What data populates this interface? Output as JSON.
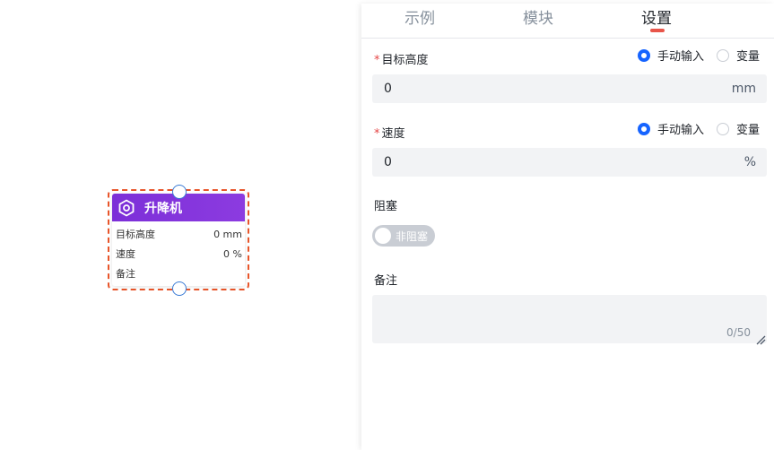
{
  "node": {
    "title": "升降机",
    "icon": "hexagon-gear-icon",
    "rows": [
      {
        "label": "目标高度",
        "value": "0 mm"
      },
      {
        "label": "速度",
        "value": "0 %"
      },
      {
        "label": "备注",
        "value": ""
      }
    ],
    "header_color": "#7c2fd8",
    "selection_color": "#e8552a"
  },
  "panel": {
    "tabs": [
      {
        "label": "示例",
        "active": false
      },
      {
        "label": "模块",
        "active": false
      },
      {
        "label": "设置",
        "active": true
      }
    ],
    "fields": {
      "target_height": {
        "required_mark": "*",
        "label": "目标高度",
        "radio_manual": "手动输入",
        "radio_variable": "变量",
        "selected": "手动输入",
        "value": "0",
        "unit": "mm"
      },
      "speed": {
        "required_mark": "*",
        "label": "速度",
        "radio_manual": "手动输入",
        "radio_variable": "变量",
        "selected": "手动输入",
        "value": "0",
        "unit": "%"
      },
      "block": {
        "label": "阻塞",
        "switch_text": "非阻塞",
        "on": false
      },
      "remark": {
        "label": "备注",
        "value": "",
        "counter": "0/50"
      }
    },
    "accent": "#1664ff"
  }
}
